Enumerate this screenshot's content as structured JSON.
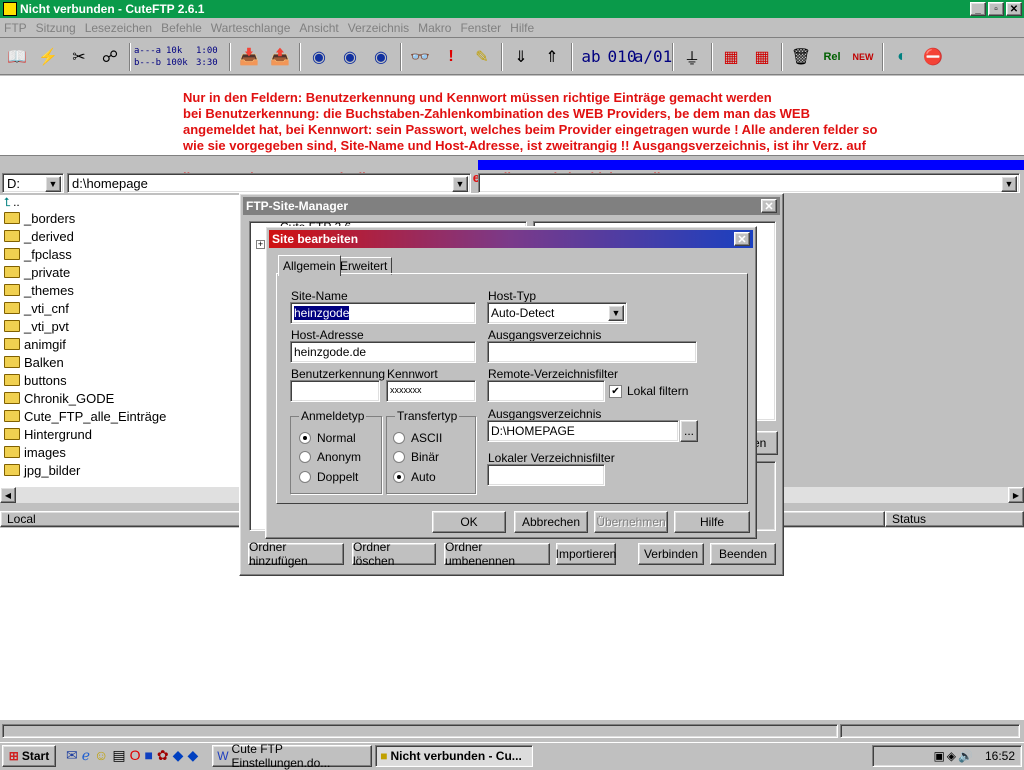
{
  "window": {
    "title": "Nicht verbunden - CuteFTP 2.6.1"
  },
  "menu": [
    "FTP",
    "Sitzung",
    "Lesezeichen",
    "Befehle",
    "Warteschlange",
    "Ansicht",
    "Verzeichnis",
    "Makro",
    "Fenster",
    "Hilfe"
  ],
  "toolbar": {
    "transfer_labels": [
      "a---a",
      "b---b",
      "10k",
      "100k",
      "1:00",
      "3:30",
      "ab",
      "010",
      "a/01"
    ]
  },
  "message": "Nur in den Feldern: Benutzerkennung und Kennwort müssen richtige Einträge gemacht werden\nbei Benutzerkennung: die Buchstaben-Zahlenkombination des WEB Providers, be dem man das WEB\nangemeldet hat, bei Kennwort: sein Passwort, welches beim Provider eingetragen wurde ! Alle anderen felder so\nwie sie vorgegeben sind, Site-Name und Host-Adresse, ist zweitrangig !! Ausgangsverzeichnis, ist ihr Verz. auf\n\nihrer Festplatte, von wo sie die Homepage aus erstellen, und abschicken wollen !",
  "local": {
    "drive": "D:",
    "path": "d:\\homepage",
    "up": "..",
    "folders": [
      "_borders",
      "_derived",
      "_fpclass",
      "_private",
      "_themes",
      "_vti_cnf",
      "_vti_pvt",
      "animgif",
      "Balken",
      "buttons",
      "Chronik_GODE",
      "Cute_FTP_alle_Einträge",
      "Hintergrund",
      "images",
      "jpg_bilder"
    ]
  },
  "queue": {
    "col_local": "Local",
    "col_status": "Status"
  },
  "site_manager": {
    "title": "FTP-Site-Manager",
    "tree_partial": "Cute FTP 2.6",
    "side_btn_partial": "iten",
    "buttons": [
      "Ordner hinzufügen",
      "Ordner löschen",
      "Ordner umbenennen",
      "Importieren",
      "Verbinden",
      "Beenden"
    ]
  },
  "site_edit": {
    "title": "Site bearbeiten",
    "tabs": [
      "Allgemein",
      "Erweitert"
    ],
    "site_name_label": "Site-Name",
    "site_name": "heinzgode",
    "host_addr_label": "Host-Adresse",
    "host_addr": "heinzgode.de",
    "user_label": "Benutzerkennung",
    "user": "",
    "pass_label": "Kennwort",
    "pass": "xxxxxxx",
    "host_type_label": "Host-Typ",
    "host_type": "Auto-Detect",
    "start_dir_label": "Ausgangsverzeichnis",
    "start_dir": "",
    "remote_filter_label": "Remote-Verzeichnisfilter",
    "remote_filter": "",
    "local_filter_check": "Lokal filtern",
    "local_dir_label": "Ausgangsverzeichnis",
    "local_dir": "D:\\HOMEPAGE",
    "browse": "...",
    "local_dir_filter_label": "Lokaler Verzeichnisfilter",
    "local_dir_filter": "",
    "login_group": "Anmeldetyp",
    "login_opts": [
      "Normal",
      "Anonym",
      "Doppelt"
    ],
    "transfer_group": "Transfertyp",
    "transfer_opts": [
      "ASCII",
      "Binär",
      "Auto"
    ],
    "ok": "OK",
    "cancel": "Abbrechen",
    "apply": "Übernehmen",
    "help": "Hilfe"
  },
  "taskbar": {
    "start": "Start",
    "task1": "Cute FTP Einstellungen.do...",
    "task2": "Nicht verbunden - Cu...",
    "clock": "16:52"
  }
}
